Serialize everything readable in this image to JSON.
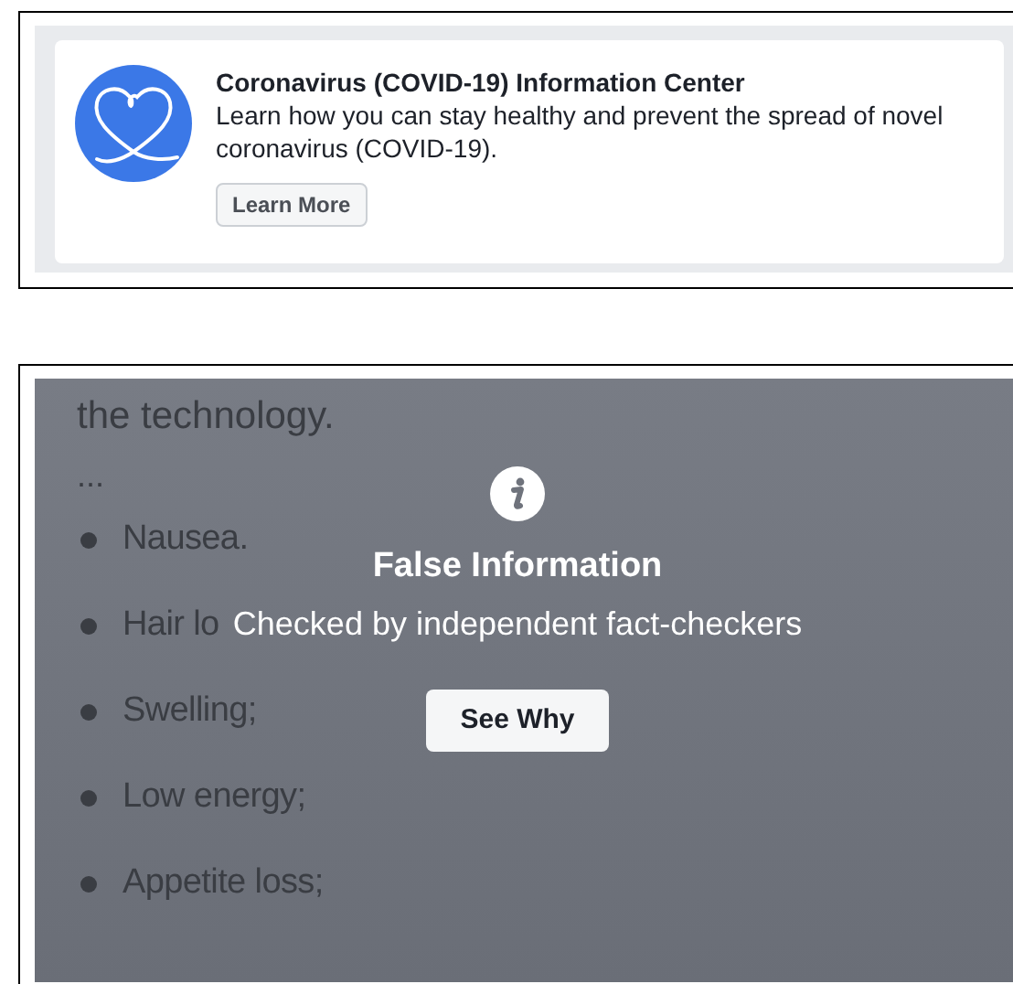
{
  "info_card": {
    "title": "Coronavirus (COVID-19) Information Center",
    "description": "Learn how you can stay healthy and prevent the spread of novel coronavirus (COVID-19).",
    "button": "Learn More"
  },
  "covered_post": {
    "lines": [
      "the technology.",
      "..."
    ],
    "bullets": [
      "Nausea.",
      "Hair lo",
      "Swelling;",
      "Low energy;",
      "Appetite loss;"
    ]
  },
  "warning_overlay": {
    "title": "False Information",
    "subtitle": "Checked by independent fact-checkers",
    "button": "See Why"
  }
}
